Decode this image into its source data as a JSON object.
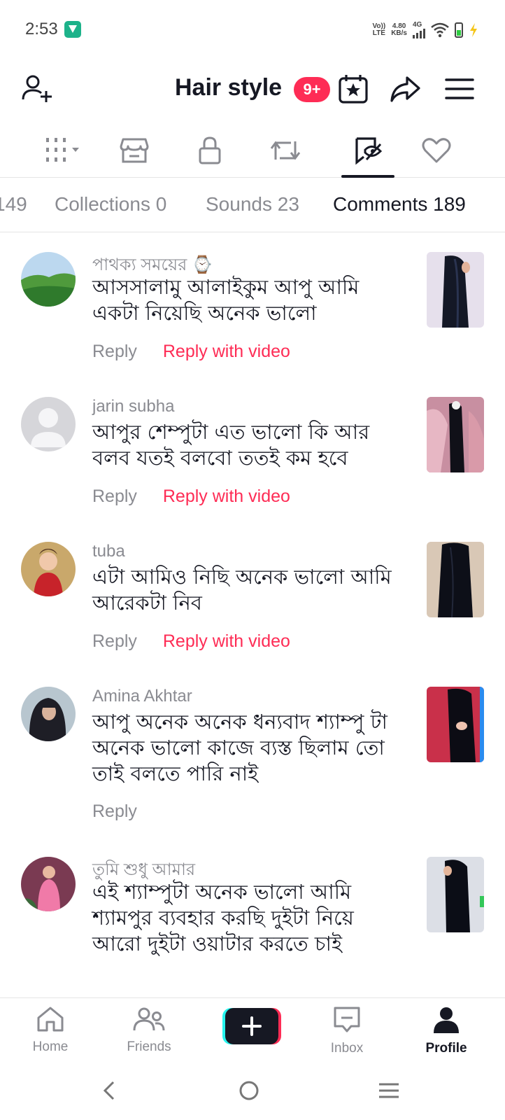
{
  "status_bar": {
    "time": "2:53",
    "network_top": "Vo))",
    "network_bottom": "LTE",
    "speed_top": "4.80",
    "speed_bottom": "KB/s",
    "signal_label": "4G"
  },
  "header": {
    "title": "Hair style",
    "badge": "9+",
    "icons": [
      "add-user-icon",
      "calendar-star-icon",
      "share-icon",
      "menu-icon"
    ]
  },
  "profile_tabs": {
    "icons": [
      "grid-icon",
      "shop-icon",
      "lock-icon",
      "repost-icon",
      "tagged-icon",
      "heart-icon"
    ],
    "active_index": 4
  },
  "sub_tabs": [
    {
      "label": "149"
    },
    {
      "label": "Collections 0"
    },
    {
      "label": "Sounds 23"
    },
    {
      "label": "Comments 189",
      "active": true
    }
  ],
  "comments": [
    {
      "user": "পাথক্য সময়ের ⌚",
      "text": "আসসালামু আলাইকুম আপু আমি একটা নিয়েছি অনেক ভালো",
      "reply": "Reply",
      "reply_video": "Reply with video",
      "avatar_color": "#3d8a3a"
    },
    {
      "user": "jarin subha",
      "text": "আপুর শেম্পুটা এত ভালো কি আর বলব যতই বলবো ততই কম হবে",
      "reply": "Reply",
      "reply_video": "Reply with video",
      "avatar_color": "#d6d6da"
    },
    {
      "user": "tuba",
      "text": "এটা আমিও নিছি অনেক ভালো আমি আরেকটা নিব",
      "reply": "Reply",
      "reply_video": "Reply with video",
      "avatar_color": "#b83a2e"
    },
    {
      "user": "Amina Akhtar",
      "text": "আপু অনেক অনেক ধন্যবাদ শ্যাম্পু টা অনেক ভালো কাজে ব্যস্ত ছিলাম তো তাই বলতে পারি নাই",
      "reply": "Reply",
      "avatar_color": "#2a2a30"
    },
    {
      "user": "তুমি শুধু আমার",
      "text": "এই শ্যাম্পুটা অনেক ভালো আমি শ্যামপুর ব্যবহার করছি দুইটা নিয়ে আরো দুইটা ওয়াটার করতে চাই",
      "avatar_color": "#c95a7a"
    }
  ],
  "bottom_nav": [
    {
      "label": "Home",
      "icon": "home-icon"
    },
    {
      "label": "Friends",
      "icon": "friends-icon"
    },
    {
      "label": "",
      "icon": "create-plus-icon"
    },
    {
      "label": "Inbox",
      "icon": "inbox-icon"
    },
    {
      "label": "Profile",
      "icon": "profile-icon",
      "active": true
    }
  ],
  "colors": {
    "accent": "#fe2c55",
    "text_primary": "#161823",
    "text_secondary": "#8a8b91"
  }
}
